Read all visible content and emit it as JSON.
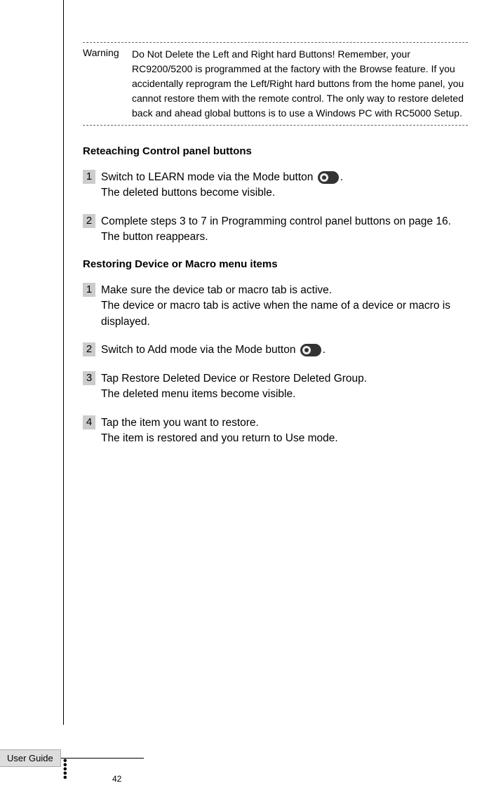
{
  "warning": {
    "label": "Warning",
    "text": "Do Not Delete the Left and Right hard Buttons! Remember, your RC9200/5200 is programmed at the factory with the Browse feature. If you accidentally reprogram the Left/Right hard buttons from the home panel, you cannot restore them with the remote control. The only way to restore deleted back and ahead global buttons is to use a Windows PC with RC5000 Setup."
  },
  "section1": {
    "heading": "Reteaching Control panel buttons",
    "steps": [
      {
        "num": "1",
        "text_before": "Switch to LEARN mode via the Mode button ",
        "text_after": ".",
        "result": "The deleted buttons become visible."
      },
      {
        "num": "2",
        "text": "Complete steps 3 to 7 in  Programming control panel buttons on page 16.",
        "result": "The button reappears."
      }
    ]
  },
  "section2": {
    "heading": "Restoring Device or Macro menu items",
    "steps": [
      {
        "num": "1",
        "text": "Make sure the device tab or macro tab is active.",
        "result": "The device or macro tab is active when the name of a device or macro is displayed."
      },
      {
        "num": "2",
        "text_before": "Switch to Add mode via the Mode button ",
        "text_after": "."
      },
      {
        "num": "3",
        "text": "Tap Restore Deleted Device or Restore Deleted Group.",
        "result": "The deleted menu items become visible."
      },
      {
        "num": "4",
        "text": "Tap the item you want to restore.",
        "result": "The item is restored and you return to Use mode."
      }
    ]
  },
  "footer": {
    "label": "User Guide",
    "page": "42"
  }
}
